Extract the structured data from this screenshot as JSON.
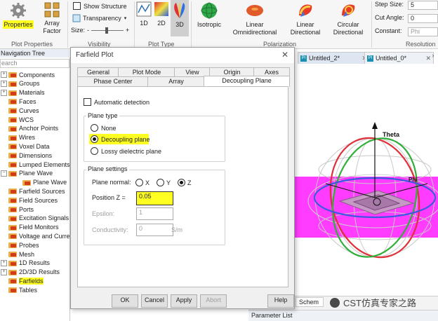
{
  "ribbon": {
    "properties_label": "Properties",
    "array_factor_label": "Array\nFactor",
    "show_structure_label": "Show Structure",
    "transparency_label": "Transparency",
    "size_label": "Size:",
    "btn_1d": "1D",
    "btn_2d": "2D",
    "btn_3d": "3D",
    "isotropic_label": "Isotropic",
    "linear_omni_label": "Linear\nOmnidirectional",
    "linear_dir_label": "Linear\nDirectional",
    "circular_dir_label": "Circular\nDirectional",
    "step_size_label": "Step Size:",
    "step_size_value": "5",
    "cut_angle_label": "Cut Angle:",
    "cut_angle_value": "0",
    "constant_label": "Constant:",
    "constant_value": "Phi",
    "groups": {
      "plot_properties": "Plot Properties",
      "visibility": "Visibility",
      "plot_type": "Plot Type",
      "polarization": "Polarization",
      "resolution": "Resolution"
    }
  },
  "tree": {
    "title": "Navigation Tree",
    "search_placeholder": "earch",
    "items": [
      "Components",
      "Groups",
      "Materials",
      "Faces",
      "Curves",
      "WCS",
      "Anchor Points",
      "Wires",
      "Voxel Data",
      "Dimensions",
      "Lumped Elements",
      "Plane Wave",
      "Plane Wave",
      "Farfield Sources",
      "Field Sources",
      "Ports",
      "Excitation Signals",
      "Field Monitors",
      "Voltage and Curren",
      "Probes",
      "Mesh",
      "1D Results",
      "2D/3D Results",
      "Farfields",
      "Tables"
    ]
  },
  "doc_tabs": [
    "Untitled_2*",
    "Untitled_0*"
  ],
  "dialog": {
    "title": "Farfield Plot",
    "tabs_row1": [
      "General",
      "Plot Mode",
      "View",
      "Origin",
      "Axes"
    ],
    "tabs_row2": [
      "Phase Center",
      "Array",
      "Decoupling Plane"
    ],
    "automatic_detection": "Automatic detection",
    "plane_type_title": "Plane type",
    "plane_type_options": [
      "None",
      "Decoupling plane",
      "Lossy dielectric plane"
    ],
    "plane_settings_title": "Plane settings",
    "plane_normal_label": "Plane normal:",
    "normal_options": [
      "X",
      "Y",
      "Z"
    ],
    "position_z_label": "Position Z =",
    "position_z_value": "0.05",
    "epsilon_label": "Epsilon:",
    "epsilon_value": "1",
    "conductivity_label": "Conductivity:",
    "conductivity_value": "0",
    "conductivity_unit": "S/m",
    "buttons": [
      "OK",
      "Cancel",
      "Apply",
      "Abort",
      "Help"
    ]
  },
  "plot": {
    "theta_label": "Theta",
    "phi_label": "Phi"
  },
  "bottom": {
    "schematic_tab": "Schem",
    "parameter_list": "Parameter List",
    "watermark": "CST仿真专家之路"
  },
  "colors": {
    "highlight": "#ffff22",
    "plane_magenta": "#ff3cff"
  }
}
